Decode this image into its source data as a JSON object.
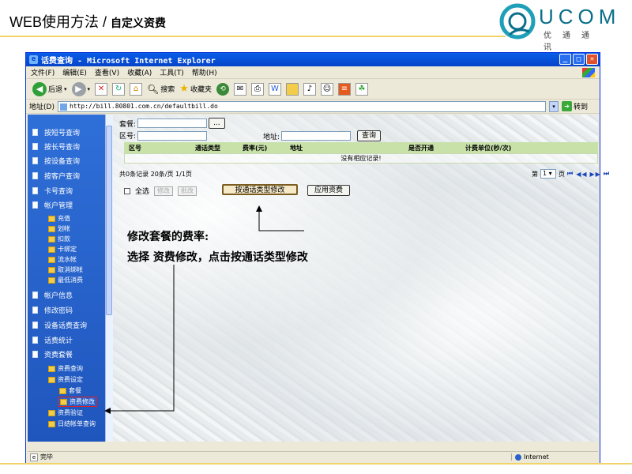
{
  "slide": {
    "title": "WEB使用方法 / ",
    "subtitle": "自定义资费",
    "brand": "UCOM",
    "brand_sub": "优通通讯"
  },
  "window": {
    "title": "话费查询 - Microsoft Internet Explorer",
    "menu": [
      "文件(F)",
      "编辑(E)",
      "查看(V)",
      "收藏(A)",
      "工具(T)",
      "帮助(H)"
    ],
    "toolbar": {
      "back_label": "后退",
      "search_label": "搜索",
      "favorites_label": "收藏夹"
    },
    "address": {
      "label": "地址(D)",
      "url": "http://bill.80801.com.cn/defaultbill.do",
      "go_label": "转到"
    },
    "status": {
      "left": "完毕",
      "zone": "Internet"
    }
  },
  "sidebar": {
    "items": [
      "按短号查询",
      "按长号查询",
      "按设备查询",
      "按客户查询",
      "卡号查询",
      "帐户管理"
    ],
    "account_sub": [
      "充值",
      "划帐",
      "扣款",
      "卡绑定",
      "流水帐",
      "取消绑帐",
      "最低消费"
    ],
    "items2": [
      "帐户信息",
      "修改密码",
      "设备话费查询",
      "话费统计",
      "资费套餐"
    ],
    "plan_sub": [
      "资费查询",
      "资费设定"
    ],
    "plan_setting_sub": [
      "套餐",
      "资费修改"
    ],
    "items3": [
      "资费验证",
      "日结帐单查询"
    ]
  },
  "form": {
    "package_label": "套餐:",
    "browse_label": "...",
    "area_label": "区号:",
    "address_label": "地址:",
    "query_button": "查询"
  },
  "grid": {
    "columns": [
      "区号",
      "通话类型",
      "费率(元)",
      "地址",
      "是否开通",
      "计费单位(秒/次)"
    ],
    "empty_text": "没有相应记录!"
  },
  "pager": {
    "summary": "共0条记录  20条/页  1/1页",
    "page_prefix": "第",
    "page_value": "1",
    "page_suffix": "页"
  },
  "actions": {
    "select_all": "全选",
    "modify": "修改",
    "batch_modify": "批改",
    "modify_by_type": "按通话类型修改",
    "apply_tariff": "应用资费"
  },
  "annotations": {
    "line1": "修改套餐的费率:",
    "line2": "选择 资费修改，点击按通话类型修改"
  }
}
